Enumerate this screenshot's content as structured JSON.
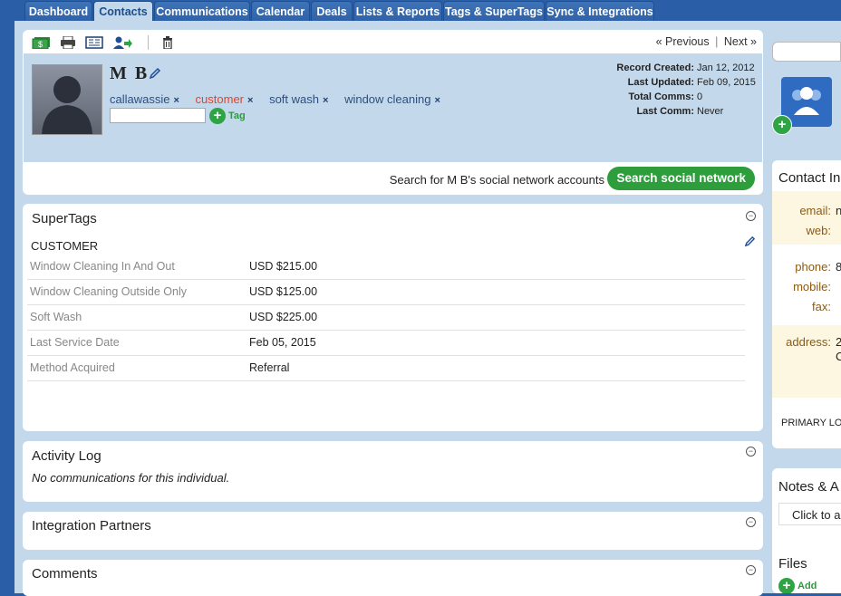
{
  "nav": {
    "tabs": [
      {
        "label": "Dashboard"
      },
      {
        "label": "Contacts"
      },
      {
        "label": "Communications"
      },
      {
        "label": "Calendar"
      },
      {
        "label": "Deals"
      },
      {
        "label": "Lists & Reports"
      },
      {
        "label": "Tags & SuperTags"
      },
      {
        "label": "Sync & Integrations"
      }
    ]
  },
  "pager": {
    "previous": "« Previous",
    "sep": "|",
    "next": "Next »"
  },
  "contact": {
    "name": "M B",
    "tags": [
      {
        "label": "callawassie"
      },
      {
        "label": "customer"
      },
      {
        "label": "soft wash"
      },
      {
        "label": "window cleaning"
      }
    ],
    "tag_remove": "×",
    "add_tag_label": "Tag",
    "meta": {
      "created_label": "Record Created:",
      "created": "Jan 12, 2012",
      "updated_label": "Last Updated:",
      "updated": "Feb 09, 2015",
      "comms_label": "Total Comms:",
      "comms": "0",
      "lastcomm_label": "Last Comm:",
      "lastcomm": "Never"
    }
  },
  "social": {
    "text": "Search for M B's social network accounts",
    "button": "Search social network"
  },
  "supertags": {
    "title": "SuperTags",
    "group": "CUSTOMER",
    "rows": [
      {
        "label": "Window Cleaning In And Out",
        "value": "USD $215.00"
      },
      {
        "label": "Window Cleaning Outside Only",
        "value": "USD $125.00"
      },
      {
        "label": "Soft Wash",
        "value": "USD $225.00"
      },
      {
        "label": "Last Service Date",
        "value": "Feb 05, 2015"
      },
      {
        "label": "Method Acquired",
        "value": "Referral"
      }
    ]
  },
  "activity": {
    "title": "Activity Log",
    "empty": "No communications for this individual."
  },
  "integration": {
    "title": "Integration Partners"
  },
  "comments": {
    "title": "Comments"
  },
  "collapse_symbol": "−",
  "right": {
    "contact_title": "Contact In",
    "email_label": "email:",
    "email_value": "n",
    "web_label": "web:",
    "phone_label": "phone:",
    "phone_value": "8",
    "mobile_label": "mobile:",
    "fax_label": "fax:",
    "address_label": "address:",
    "address_line1": "2",
    "address_line2": "C",
    "primary_label": "PRIMARY LO",
    "notes_title": "Notes & A",
    "notes_click": "Click to a",
    "files_title": "Files",
    "add_label": "Add"
  },
  "colors": {
    "nav": "#2a5ea6",
    "bg": "#c4d8ec",
    "green": "#2e9e3c",
    "label_brown": "#8a5a16",
    "tag_red": "#e0442a"
  }
}
